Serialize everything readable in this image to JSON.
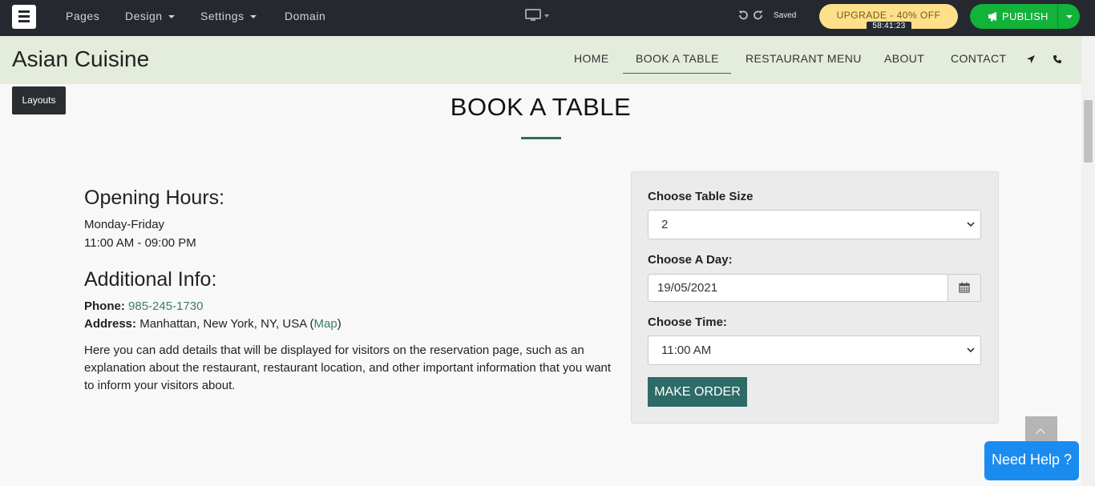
{
  "editor": {
    "menu": [
      {
        "label": "Pages",
        "dropdown": false
      },
      {
        "label": "Design",
        "dropdown": true
      },
      {
        "label": "Settings",
        "dropdown": true
      },
      {
        "label": "Domain",
        "dropdown": false
      }
    ],
    "saved_label": "Saved",
    "upgrade_label": "UPGRADE - 40% OFF",
    "timer": "58:41:23",
    "publish_label": "PUBLISH"
  },
  "site": {
    "title": "Asian Cuisine",
    "nav": [
      {
        "label": "HOME"
      },
      {
        "label": "BOOK A TABLE",
        "active": true
      },
      {
        "label": "RESTAURANT MENU"
      },
      {
        "label": "ABOUT"
      },
      {
        "label": "CONTACT"
      }
    ]
  },
  "layouts_label": "Layouts",
  "page": {
    "title": "BOOK A TABLE",
    "opening_hours": {
      "heading": "Opening Hours:",
      "days": "Monday-Friday",
      "hours": "11:00 AM - 09:00 PM"
    },
    "additional_info": {
      "heading": "Additional Info:",
      "phone_label": "Phone:",
      "phone": "985-245-1730",
      "address_label": "Address:",
      "address": "Manhattan, New York, NY, USA (",
      "map_link": "Map",
      "address_close": ")",
      "description": "Here you can add details that will be displayed for visitors on the reservation page, such as an explanation about the restaurant, restaurant location, and other important information that you want to inform your visitors about."
    }
  },
  "form": {
    "table_size_label": "Choose Table Size",
    "table_size_value": "2",
    "day_label": "Choose A Day:",
    "day_value": "19/05/2021",
    "time_label": "Choose Time:",
    "time_value": "11:00 AM",
    "submit_label": "MAKE ORDER"
  },
  "help_label": "Need Help ?",
  "colors": {
    "accent": "#2d6b66",
    "publish": "#12b23b",
    "upgrade": "#ffe08a",
    "help": "#1a8cf0",
    "header_bg": "#e4ecdb",
    "topbar_bg": "#25292f"
  }
}
